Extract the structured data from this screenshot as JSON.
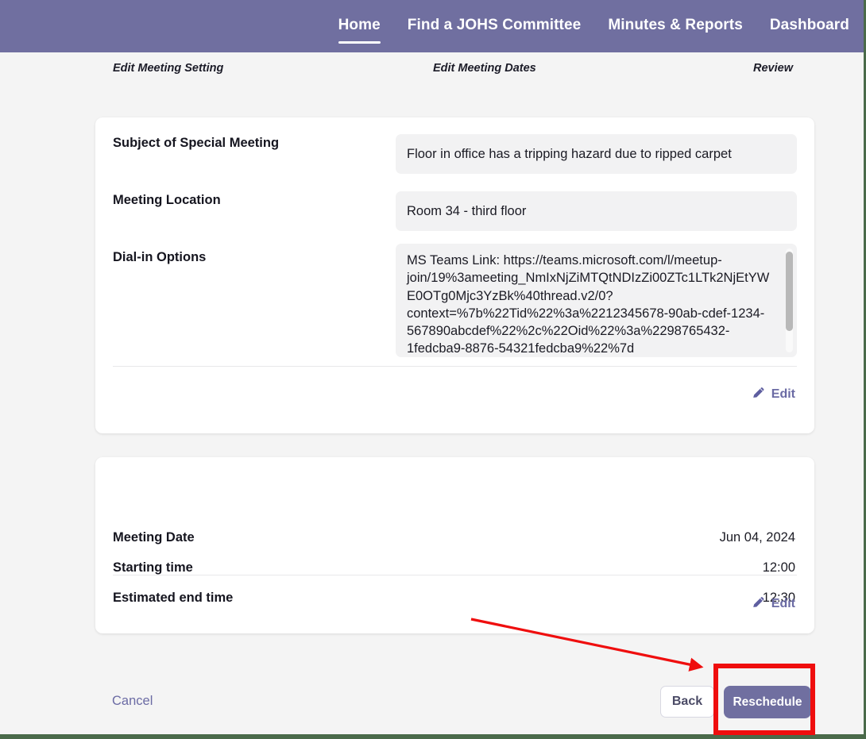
{
  "nav": {
    "items": [
      {
        "label": "Home",
        "active": true
      },
      {
        "label": "Find a JOHS Committee",
        "active": false
      },
      {
        "label": "Minutes & Reports",
        "active": false
      },
      {
        "label": "Dashboard",
        "active": false
      }
    ]
  },
  "stepper": {
    "steps": [
      {
        "label": "Edit Meeting Setting"
      },
      {
        "label": "Edit Meeting Dates"
      },
      {
        "label": "Review"
      }
    ]
  },
  "details_card": {
    "fields": [
      {
        "label": "Subject of Special Meeting",
        "value": "Floor in office has a tripping hazard due to ripped carpet"
      },
      {
        "label": "Meeting Location",
        "value": "Room 34 - third floor"
      },
      {
        "label": "Dial-in Options",
        "value": "MS Teams Link: https://teams.microsoft.com/l/meetup-join/19%3ameeting_NmIxNjZiMTQtNDIzZi00ZTc1LTk2NjEtYWE0OTg0Mjc3YzBk%40thread.v2/0?context=%7b%22Tid%22%3a%2212345678-90ab-cdef-1234-567890abcdef%22%2c%22Oid%22%3a%2298765432-1fedcba9-8876-54321fedcba9%22%7d"
      }
    ],
    "edit_label": "Edit"
  },
  "schedule_card": {
    "rows": [
      {
        "label": "Meeting Date",
        "value": "Jun 04, 2024"
      },
      {
        "label": "Starting time",
        "value": "12:00"
      },
      {
        "label": "Estimated end time",
        "value": "12:30"
      }
    ],
    "edit_label": "Edit"
  },
  "footer": {
    "cancel_label": "Cancel",
    "back_label": "Back",
    "reschedule_label": "Reschedule"
  },
  "icons": {
    "pencil": "pencil-icon",
    "arrow": "red-arrow-annotation",
    "highlight": "red-highlight-box"
  },
  "colors": {
    "brand_purple": "#706fa0",
    "link_purple": "#6b6ba4",
    "annotation_red": "#ef0e0e",
    "page_background": "#f4f4f4",
    "card_background": "#ffffff",
    "field_background": "#f2f2f3",
    "window_border_green": "#4a6a4a"
  }
}
